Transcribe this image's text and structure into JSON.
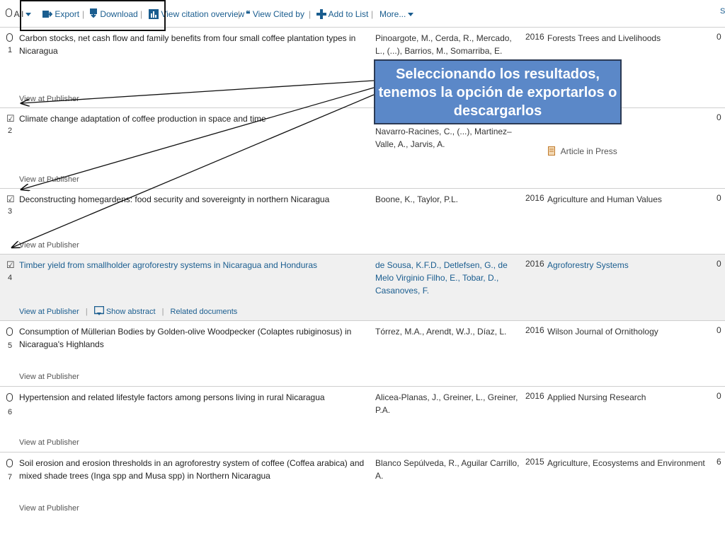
{
  "toolbar": {
    "select_all_label": "All",
    "export_label": "Export",
    "download_label": "Download",
    "citation_overview_label": "View citation overview",
    "cited_by_label": "View Cited by",
    "add_to_list_label": "Add to List",
    "more_label": "More...",
    "separator": "|",
    "right_fragment": "S"
  },
  "results": [
    {
      "num": "1",
      "title": "Carbon stocks, net cash flow and family benefits from four small coffee plantation types in Nicaragua",
      "authors": "Pinoargote, M., Cerda, R., Mercado, L., (...), Barrios, M., Somarriba, E.",
      "year": "2016",
      "source": "Forests Trees and Livelihoods",
      "cited": "0",
      "view_at_publisher": "View at Publisher",
      "checked": false
    },
    {
      "num": "2",
      "title": "Climate change adaptation of coffee production in space and time",
      "authors": "Navarro-Racines, C., (...), Martinez–Valle, A., Jarvis, A.",
      "year": "",
      "source": "",
      "cited": "0",
      "view_at_publisher": "View at Publisher",
      "checked": true,
      "extra": "Article in Press"
    },
    {
      "num": "3",
      "title": "Deconstructing homegardens: food security and sovereignty in northern Nicaragua",
      "authors": "Boone, K., Taylor, P.L.",
      "year": "2016",
      "source": "Agriculture and Human Values",
      "cited": "0",
      "view_at_publisher": "View at Publisher",
      "checked": true
    },
    {
      "num": "4",
      "title": "Timber yield from smallholder agroforestry systems in Nicaragua and Honduras",
      "authors": "de Sousa, K.F.D., Detlefsen, G., de Melo Virginio Filho, E., Tobar, D., Casanoves, F.",
      "year": "2016",
      "source": "Agroforestry Systems",
      "cited": "0",
      "view_at_publisher": "View at Publisher",
      "show_abstract": "Show abstract",
      "related_documents": "Related documents",
      "checked": true
    },
    {
      "num": "5",
      "title": "Consumption of Müllerian Bodies by Golden-olive Woodpecker (Colaptes rubiginosus) in Nicaragua's Highlands",
      "authors": "Tórrez, M.A., Arendt, W.J., Díaz, L.",
      "year": "2016",
      "source": "Wilson Journal of Ornithology",
      "cited": "0",
      "view_at_publisher": "View at Publisher",
      "checked": false
    },
    {
      "num": "6",
      "title": "Hypertension and related lifestyle factors among persons living in rural Nicaragua",
      "authors": "Alicea-Planas, J., Greiner, L., Greiner, P.A.",
      "year": "2016",
      "source": "Applied Nursing Research",
      "cited": "0",
      "view_at_publisher": "View at Publisher",
      "checked": false
    },
    {
      "num": "7",
      "title": "Soil erosion and erosion thresholds in an agroforestry system of coffee (Coffea arabica) and mixed shade trees (Inga spp and Musa spp) in Northern Nicaragua",
      "authors": "Blanco Sepúlveda, R., Aguilar Carrillo, A.",
      "year": "2015",
      "source": "Agriculture, Ecosystems and Environment",
      "cited": "6",
      "view_at_publisher": "View at Publisher",
      "checked": false
    }
  ],
  "callout": {
    "text": "Seleccionando los resultados, tenemos la opción de exportarlos o descargarlos"
  },
  "colors": {
    "link": "#1a5d8f",
    "callout_bg": "#5b88c8",
    "callout_border": "#2c3b55",
    "highlight_row": "#f0f0f0"
  },
  "icons": {
    "export": "export-icon",
    "download": "download-icon",
    "citation": "bar-chart-icon",
    "cited_by": "quote-icon",
    "add": "plus-icon",
    "abstract": "abstract-icon",
    "press": "document-icon"
  }
}
